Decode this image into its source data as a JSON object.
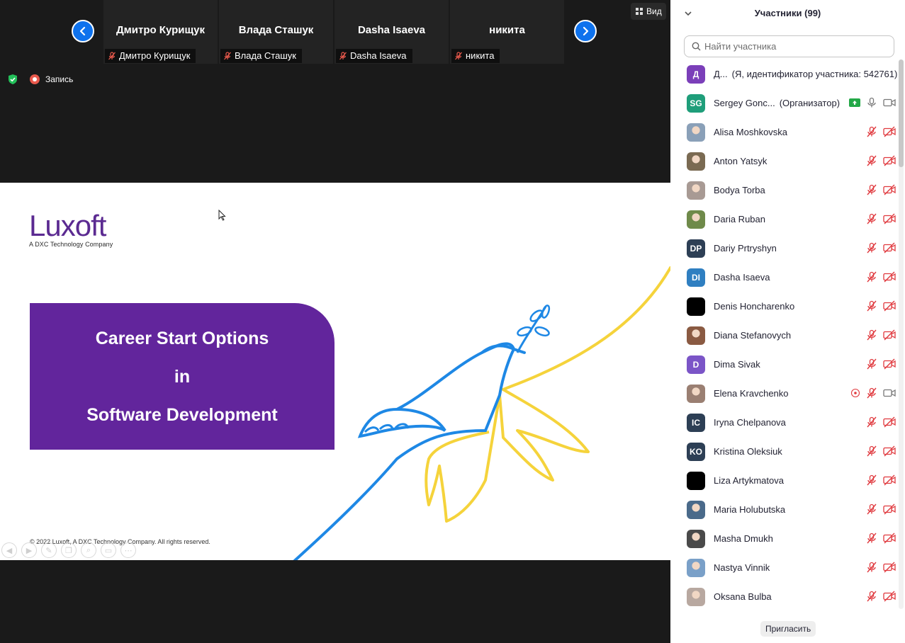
{
  "meeting": {
    "view_label": "Вид",
    "recording_label": "Запись",
    "gallery": [
      {
        "name": "Дмитро Курищук",
        "label": "Дмитро Курищук"
      },
      {
        "name": "Влада Сташук",
        "label": "Влада Сташук"
      },
      {
        "name": "Dasha Isaeva",
        "label": "Dasha Isaeva"
      },
      {
        "name": "никита",
        "label": "никита"
      }
    ]
  },
  "slide": {
    "logo_word": "Luxoft",
    "logo_sub": "A DXC Technology Company",
    "title_lines": [
      "Career Start Options",
      "in",
      "Software Development"
    ],
    "copyright": "© 2022 Luxoft, A DXC Technology Company. All rights reserved.",
    "colors": {
      "brand_purple": "#62259c",
      "dove_blue": "#1e88e5",
      "dove_yellow": "#f5d33b"
    }
  },
  "panel": {
    "title": "Участники (99)",
    "search_placeholder": "Найти участника",
    "invite_label": "Пригласить",
    "participants": [
      {
        "name": "Д...",
        "tag": "(Я, идентификатор участника: 542761)",
        "initials": "Д",
        "color": "#7b3fb9",
        "photo": false,
        "state": "self"
      },
      {
        "name": "Sergey Gonc...",
        "tag": "(Организатор)",
        "initials": "SG",
        "color": "#1f9e7a",
        "photo": false,
        "state": "host"
      },
      {
        "name": "Alisa Moshkovska",
        "initials": "",
        "color": "#8aa0b8",
        "photo": true,
        "state": "muted"
      },
      {
        "name": "Anton Yatsyk",
        "initials": "",
        "color": "#7a6a52",
        "photo": true,
        "state": "muted"
      },
      {
        "name": "Bodya Torba",
        "initials": "",
        "color": "#a89a94",
        "photo": true,
        "state": "muted"
      },
      {
        "name": "Daria Ruban",
        "initials": "",
        "color": "#6f8a4a",
        "photo": true,
        "state": "muted"
      },
      {
        "name": "Dariy Prtryshyn",
        "initials": "DP",
        "color": "#2d3f55",
        "photo": false,
        "state": "muted"
      },
      {
        "name": "Dasha Isaeva",
        "initials": "DI",
        "color": "#2f7fc1",
        "photo": false,
        "state": "muted"
      },
      {
        "name": "Denis Honcharenko",
        "initials": "",
        "color": "#000000",
        "photo": false,
        "state": "muted"
      },
      {
        "name": "Diana Stefanovych",
        "initials": "",
        "color": "#8a5a42",
        "photo": true,
        "state": "muted"
      },
      {
        "name": "Dima Sivak",
        "initials": "D",
        "color": "#7b55c7",
        "photo": false,
        "state": "muted"
      },
      {
        "name": "Elena Kravchenko",
        "initials": "",
        "color": "#9a7f72",
        "photo": true,
        "state": "raised"
      },
      {
        "name": "Iryna Chelpanova",
        "initials": "IC",
        "color": "#2d3f55",
        "photo": false,
        "state": "muted"
      },
      {
        "name": "Kristina Oleksiuk",
        "initials": "KO",
        "color": "#2d3f55",
        "photo": false,
        "state": "muted"
      },
      {
        "name": "Liza Artykmatova",
        "initials": "",
        "color": "#000000",
        "photo": false,
        "state": "muted"
      },
      {
        "name": "Maria Holubutska",
        "initials": "",
        "color": "#4a6a8a",
        "photo": true,
        "state": "muted"
      },
      {
        "name": "Masha Dmukh",
        "initials": "",
        "color": "#4a4a4a",
        "photo": true,
        "state": "muted"
      },
      {
        "name": "Nastya Vinnik",
        "initials": "",
        "color": "#7aa0c8",
        "photo": true,
        "state": "muted"
      },
      {
        "name": "Oksana Bulba",
        "initials": "",
        "color": "#b8a8a0",
        "photo": true,
        "state": "muted"
      }
    ]
  }
}
